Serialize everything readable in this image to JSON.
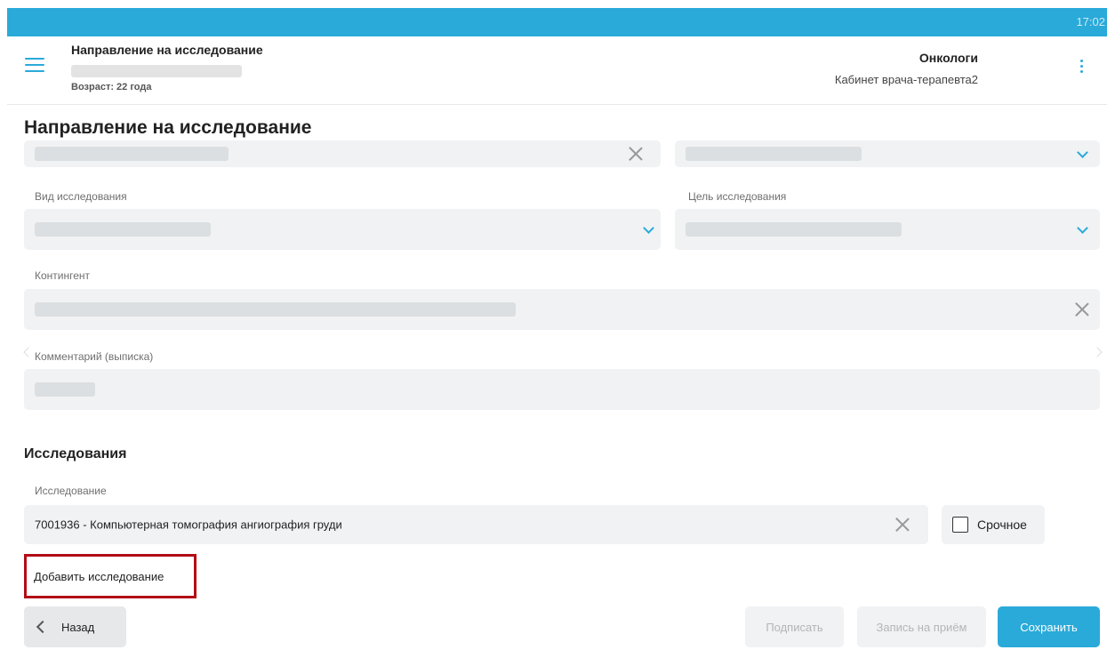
{
  "status_bar": {
    "time": "17:02"
  },
  "header": {
    "title": "Направление на исследование",
    "age": "Возраст: 22 года",
    "department": "Онкологи",
    "cabinet": "Кабинет врача-терапевта2"
  },
  "page": {
    "title": "Направление на исследование"
  },
  "fields": {
    "study_type": {
      "label": "Вид исследования"
    },
    "study_goal": {
      "label": "Цель исследования"
    },
    "contingent": {
      "label": "Контингент"
    },
    "comment": {
      "label": "Комментарий (выписка)"
    }
  },
  "studies": {
    "section_title": "Исследования",
    "item_label": "Исследование",
    "item_value": "7001936 - Компьютерная томография ангиография груди",
    "urgent_label": "Срочное",
    "add_label": "Добавить исследование"
  },
  "footer": {
    "back_label": "Назад",
    "sign_label": "Подписать",
    "appointment_label": "Запись на приём",
    "save_label": "Сохранить"
  },
  "colors": {
    "accent": "#2aaad9",
    "highlight": "#b30d16"
  }
}
